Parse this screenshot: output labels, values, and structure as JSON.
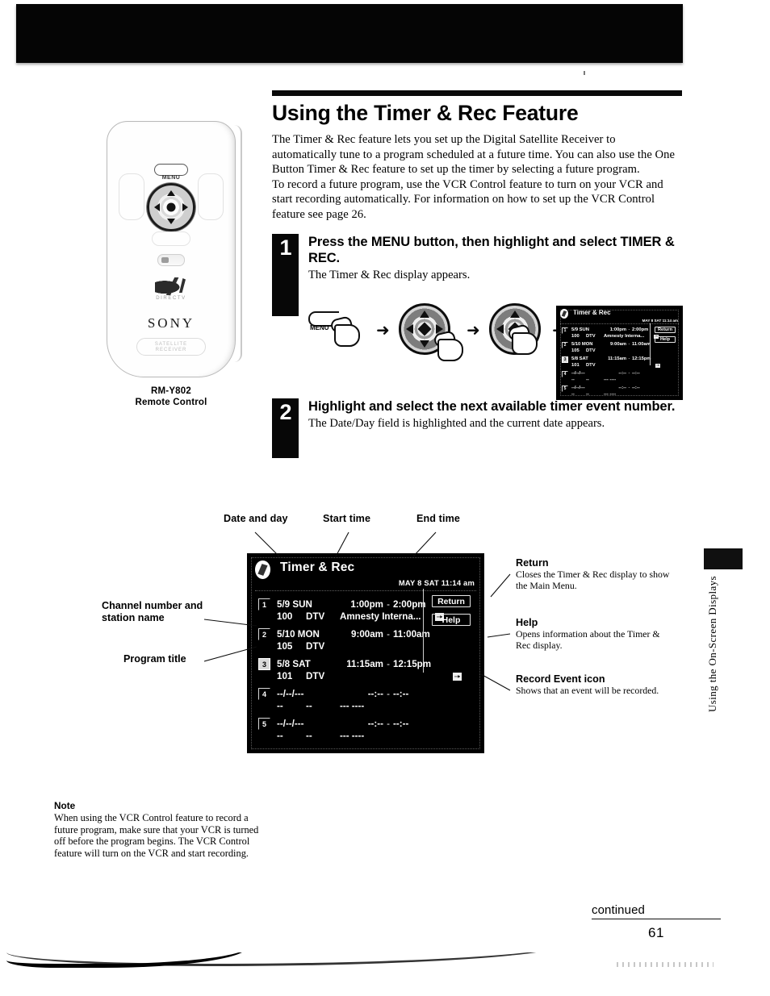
{
  "page": {
    "title": "Using the Timer & Rec Feature",
    "number": "61",
    "continued_label": "continued",
    "side_tab_label": "Using the On-Screen Displays"
  },
  "intro": {
    "paragraph1": "The Timer & Rec feature lets you set up the Digital Satellite Receiver to automatically tune to a program scheduled at a future time. You can also use the One Button Timer & Rec feature to set up the timer by selecting a future program.",
    "paragraph2": "To record a future program, use the VCR Control feature to turn on your VCR and start recording automatically. For information on how to set up the VCR Control feature see page 26."
  },
  "remote": {
    "model": "RM-Y802",
    "caption": "Remote Control",
    "menu_button_label": "MENU",
    "brand": "SONY",
    "sub_brand": "DIRECTV",
    "receiver_plate_line1": "SATELLITE",
    "receiver_plate_line2": "RECEIVER"
  },
  "steps": [
    {
      "number": "1",
      "heading": "Press the MENU button, then highlight and select TIMER & REC.",
      "subtext": "The Timer & Rec display appears.",
      "sequence": {
        "menu_label": "MENU",
        "arrow": "➜"
      }
    },
    {
      "number": "2",
      "heading": "Highlight and select the next available timer event number.",
      "subtext": "The Date/Day field is highlighted and the current date appears."
    }
  ],
  "osd": {
    "logo_name": "directv-logo-icon",
    "title": "Timer & Rec",
    "clock": "MAY  8 SAT 11:14 am",
    "buttons": [
      {
        "label": "Return"
      },
      {
        "label": "Help"
      }
    ],
    "rows": [
      {
        "num": "1",
        "selected": false,
        "date": "5/9 SUN",
        "channel": "100",
        "network": "DTV",
        "start": "1:00pm",
        "dash": "-",
        "end": "2:00pm",
        "program": "Amnesty Interna...",
        "rec_icon": true,
        "rec_icon_inline": true
      },
      {
        "num": "2",
        "selected": false,
        "date": "5/10 MON",
        "channel": "105",
        "network": "DTV",
        "start": "9:00am",
        "dash": "-",
        "end": "11:00am",
        "program": "",
        "rec_icon": false,
        "rec_icon_inline": false
      },
      {
        "num": "3",
        "selected": true,
        "date": "5/8 SAT",
        "channel": "101",
        "network": "DTV",
        "start": "11:15am",
        "dash": "-",
        "end": "12:15pm",
        "program": "",
        "rec_icon": true,
        "rec_icon_inline": false
      },
      {
        "num": "4",
        "selected": false,
        "date": "--/--/---",
        "channel": "--",
        "network": "--",
        "start": "--:--",
        "dash": "-",
        "end": "--:--",
        "program": "--- ----",
        "rec_icon": false,
        "rec_icon_inline": false
      },
      {
        "num": "5",
        "selected": false,
        "date": "--/--/---",
        "channel": "--",
        "network": "--",
        "start": "--:--",
        "dash": "-",
        "end": "--:--",
        "program": "--- ----",
        "rec_icon": false,
        "rec_icon_inline": false
      }
    ]
  },
  "callouts": {
    "top": [
      {
        "label": "Date and day"
      },
      {
        "label": "Start time"
      },
      {
        "label": "End time"
      }
    ],
    "left": [
      {
        "label": "Channel number and\nstation name"
      },
      {
        "label": "Program title"
      }
    ],
    "right": [
      {
        "title": "Return",
        "desc": "Closes the Timer & Rec display to show the Main Menu."
      },
      {
        "title": "Help",
        "desc": "Opens information about the Timer & Rec display."
      },
      {
        "title": "Record Event icon",
        "desc": "Shows that an event will be recorded."
      }
    ]
  },
  "note": {
    "title": "Note",
    "body": "When using the VCR Control feature  to record a future program, make sure that your VCR is turned off before the program begins. The VCR Control feature will turn on the VCR and start recording."
  }
}
